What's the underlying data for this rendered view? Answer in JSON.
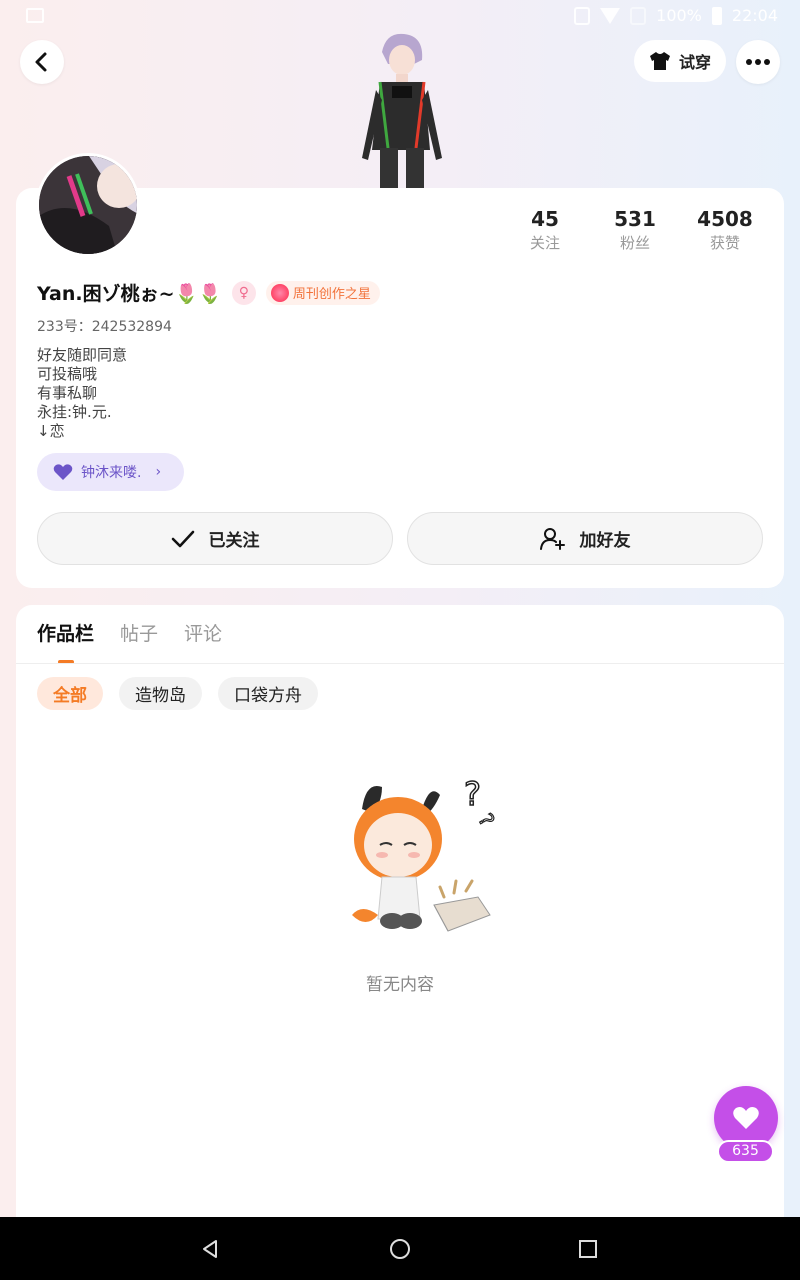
{
  "status_bar": {
    "battery": "100%",
    "time": "22:04"
  },
  "header": {
    "try_on_label": "试穿"
  },
  "profile": {
    "name": "Yan.困ゾ桃ぉ~🌷🌷",
    "badge": "周刊创作之星",
    "uid": "233号：242532894",
    "bio": [
      "好友随即同意",
      "可投稿哦",
      "有事私聊",
      "永挂:钟.元.",
      "↓恋"
    ],
    "couple_label": "钟沐来喽.",
    "stats": [
      {
        "value": "45",
        "label": "关注"
      },
      {
        "value": "531",
        "label": "粉丝"
      },
      {
        "value": "4508",
        "label": "获赞"
      }
    ],
    "follow_label": "已关注",
    "add_friend_label": "加好友"
  },
  "content": {
    "tabs": [
      "作品栏",
      "帖子",
      "评论"
    ],
    "chips": [
      "全部",
      "造物岛",
      "口袋方舟"
    ],
    "empty_text": "暂无内容"
  },
  "like_fab": {
    "count": "635"
  },
  "colors": {
    "accent": "#f47b25",
    "like": "#c44fe8",
    "couple": "#6c55c8"
  }
}
